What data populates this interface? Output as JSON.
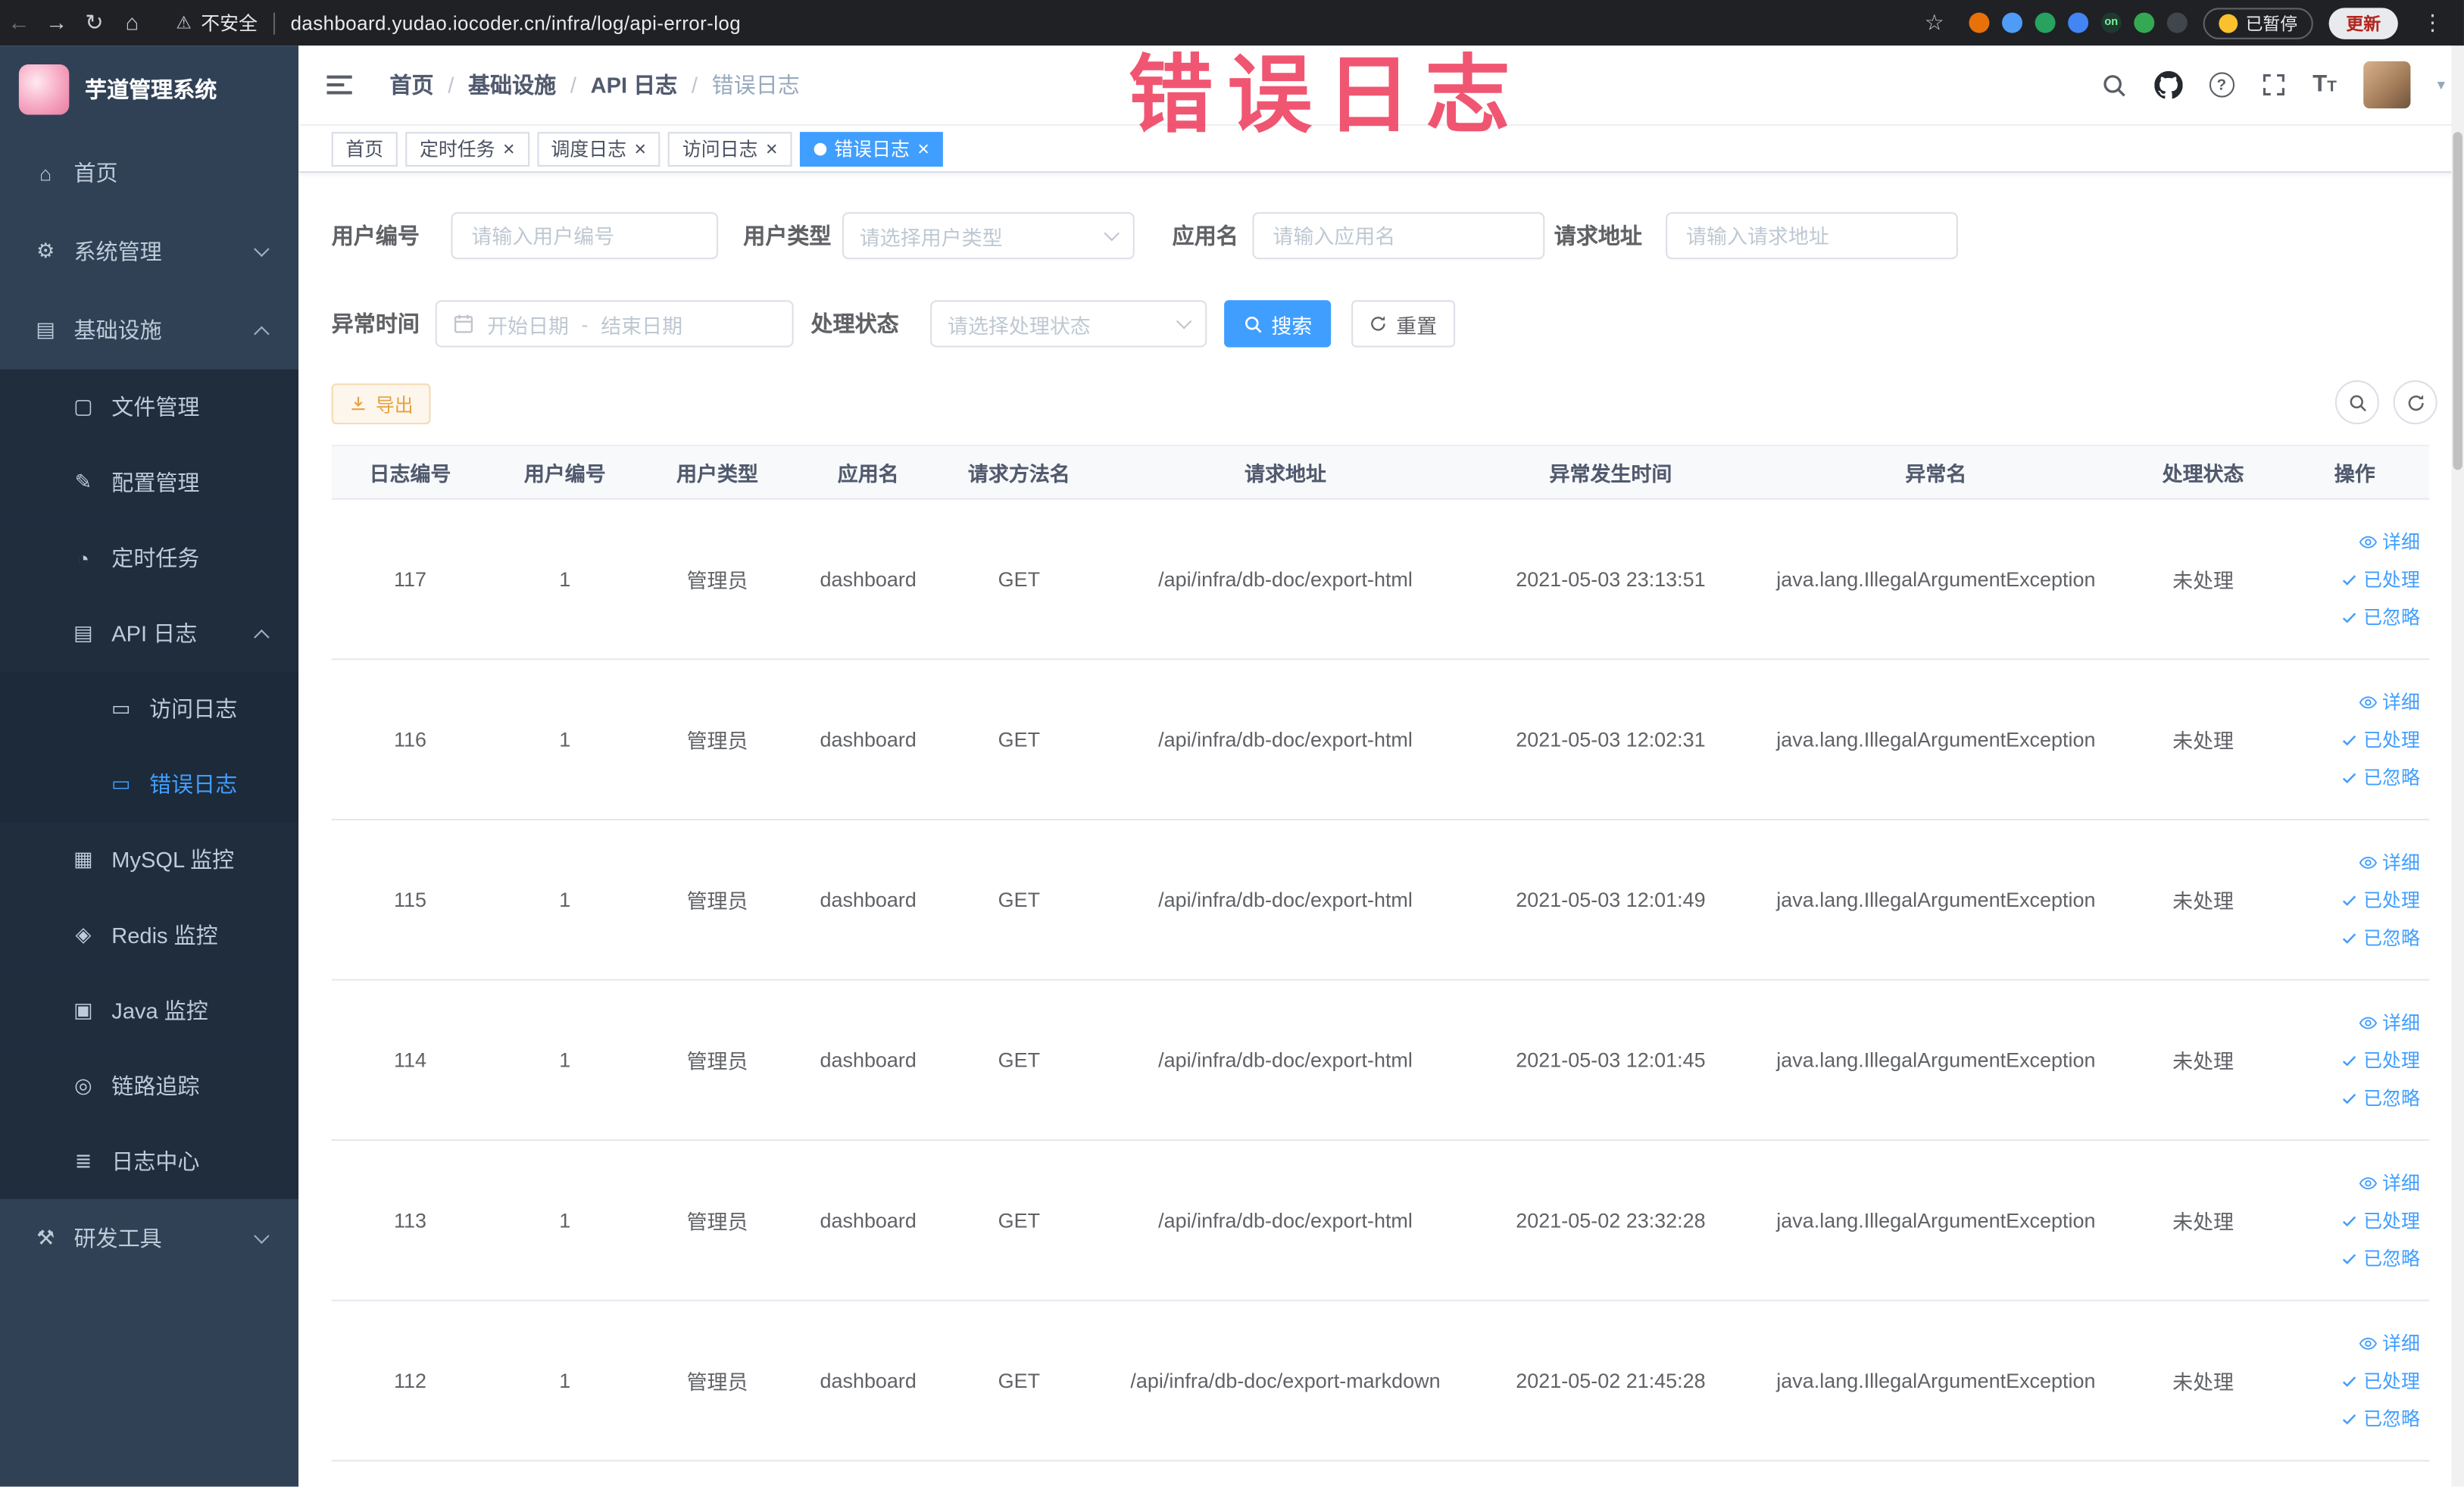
{
  "colors": {
    "accent": "#409eff",
    "warning": "#e6a23c",
    "sidebar_bg": "#304156",
    "submenu_bg": "#1f2d3d",
    "annotation_red": "#ee3f5e",
    "chrome_bg": "#1f2125"
  },
  "browser": {
    "security_warning": "不安全",
    "url": "dashboard.yudao.iocoder.cn/infra/log/api-error-log",
    "paused_badge": "已暂停",
    "update_button": "更新",
    "extensions": [
      {
        "name": "extension-icon-1",
        "color": "#e8710a"
      },
      {
        "name": "extension-icon-2",
        "color": "#4f9cf7"
      },
      {
        "name": "extension-icon-3",
        "color": "#27a25f"
      },
      {
        "name": "extension-icon-4",
        "color": "#4285f4"
      },
      {
        "name": "extension-icon-5",
        "color": "#1e3a2f",
        "label": "on"
      },
      {
        "name": "extension-icon-6",
        "color": "#35a853"
      },
      {
        "name": "extension-icon-7",
        "color": "#41464c"
      }
    ]
  },
  "annotation": {
    "text": "错误日志"
  },
  "sidebar": {
    "title": "芋道管理系统",
    "items": [
      {
        "key": "home",
        "label": "首页",
        "icon": "home-icon",
        "depth": 0
      },
      {
        "key": "system-management",
        "label": "系统管理",
        "icon": "gear-icon",
        "depth": 0,
        "chevron": "down"
      },
      {
        "key": "infrastructure",
        "label": "基础设施",
        "icon": "infra-icon",
        "depth": 0,
        "chevron": "up"
      },
      {
        "key": "file-management",
        "label": "文件管理",
        "icon": "file-icon",
        "depth": 1
      },
      {
        "key": "config-management",
        "label": "配置管理",
        "icon": "config-icon",
        "depth": 1
      },
      {
        "key": "scheduled-jobs",
        "label": "定时任务",
        "icon": "timer-icon",
        "depth": 1
      },
      {
        "key": "api-log",
        "label": "API 日志",
        "icon": "api-log-icon",
        "depth": 1,
        "chevron": "up"
      },
      {
        "key": "access-log",
        "label": "访问日志",
        "icon": "doc-icon",
        "depth": 2
      },
      {
        "key": "error-log",
        "label": "错误日志",
        "icon": "doc-icon",
        "depth": 2,
        "active": true
      },
      {
        "key": "mysql-monitor",
        "label": "MySQL 监控",
        "icon": "mysql-icon",
        "depth": 1
      },
      {
        "key": "redis-monitor",
        "label": "Redis 监控",
        "icon": "redis-icon",
        "depth": 1
      },
      {
        "key": "java-monitor",
        "label": "Java 监控",
        "icon": "java-icon",
        "depth": 1
      },
      {
        "key": "tracing",
        "label": "链路追踪",
        "icon": "trace-icon",
        "depth": 1
      },
      {
        "key": "log-center",
        "label": "日志中心",
        "icon": "log-center-icon",
        "depth": 1
      },
      {
        "key": "dev-tools",
        "label": "研发工具",
        "icon": "tools-icon",
        "depth": 0,
        "chevron": "down"
      }
    ]
  },
  "breadcrumb": {
    "separator": "/",
    "items": [
      "首页",
      "基础设施",
      "API 日志",
      "错误日志"
    ]
  },
  "tabs": [
    {
      "label": "首页",
      "closable": false,
      "active": false
    },
    {
      "label": "定时任务",
      "closable": true,
      "active": false
    },
    {
      "label": "调度日志",
      "closable": true,
      "active": false
    },
    {
      "label": "访问日志",
      "closable": true,
      "active": false
    },
    {
      "label": "错误日志",
      "closable": true,
      "active": true
    }
  ],
  "filters": {
    "user_id": {
      "label": "用户编号",
      "placeholder": "请输入用户编号"
    },
    "user_type": {
      "label": "用户类型",
      "placeholder": "请选择用户类型"
    },
    "app_name": {
      "label": "应用名",
      "placeholder": "请输入应用名"
    },
    "request_url": {
      "label": "请求地址",
      "placeholder": "请输入请求地址"
    },
    "exception_time": {
      "label": "异常时间",
      "start_placeholder": "开始日期",
      "separator": "-",
      "end_placeholder": "结束日期"
    },
    "process_status": {
      "label": "处理状态",
      "placeholder": "请选择处理状态"
    },
    "search_label": "搜索",
    "reset_label": "重置"
  },
  "toolbar": {
    "export_label": "导出"
  },
  "table": {
    "columns": [
      "日志编号",
      "用户编号",
      "用户类型",
      "应用名",
      "请求方法名",
      "请求地址",
      "异常发生时间",
      "异常名",
      "处理状态",
      "操作"
    ],
    "row_actions": [
      {
        "key": "detail",
        "label": "详细",
        "icon": "eye-icon"
      },
      {
        "key": "processed",
        "label": "已处理",
        "icon": "check-icon"
      },
      {
        "key": "ignored",
        "label": "已忽略",
        "icon": "check-icon"
      }
    ],
    "rows": [
      {
        "id": "117",
        "user_id": "1",
        "user_type": "管理员",
        "app": "dashboard",
        "method": "GET",
        "url": "/api/infra/db-doc/export-html",
        "time": "2021-05-03 23:13:51",
        "exception": "java.lang.IllegalArgumentException",
        "status": "未处理"
      },
      {
        "id": "116",
        "user_id": "1",
        "user_type": "管理员",
        "app": "dashboard",
        "method": "GET",
        "url": "/api/infra/db-doc/export-html",
        "time": "2021-05-03 12:02:31",
        "exception": "java.lang.IllegalArgumentException",
        "status": "未处理"
      },
      {
        "id": "115",
        "user_id": "1",
        "user_type": "管理员",
        "app": "dashboard",
        "method": "GET",
        "url": "/api/infra/db-doc/export-html",
        "time": "2021-05-03 12:01:49",
        "exception": "java.lang.IllegalArgumentException",
        "status": "未处理"
      },
      {
        "id": "114",
        "user_id": "1",
        "user_type": "管理员",
        "app": "dashboard",
        "method": "GET",
        "url": "/api/infra/db-doc/export-html",
        "time": "2021-05-03 12:01:45",
        "exception": "java.lang.IllegalArgumentException",
        "status": "未处理"
      },
      {
        "id": "113",
        "user_id": "1",
        "user_type": "管理员",
        "app": "dashboard",
        "method": "GET",
        "url": "/api/infra/db-doc/export-html",
        "time": "2021-05-02 23:32:28",
        "exception": "java.lang.IllegalArgumentException",
        "status": "未处理"
      },
      {
        "id": "112",
        "user_id": "1",
        "user_type": "管理员",
        "app": "dashboard",
        "method": "GET",
        "url": "/api/infra/db-doc/export-markdown",
        "time": "2021-05-02 21:45:28",
        "exception": "java.lang.IllegalArgumentException",
        "status": "未处理"
      }
    ]
  }
}
